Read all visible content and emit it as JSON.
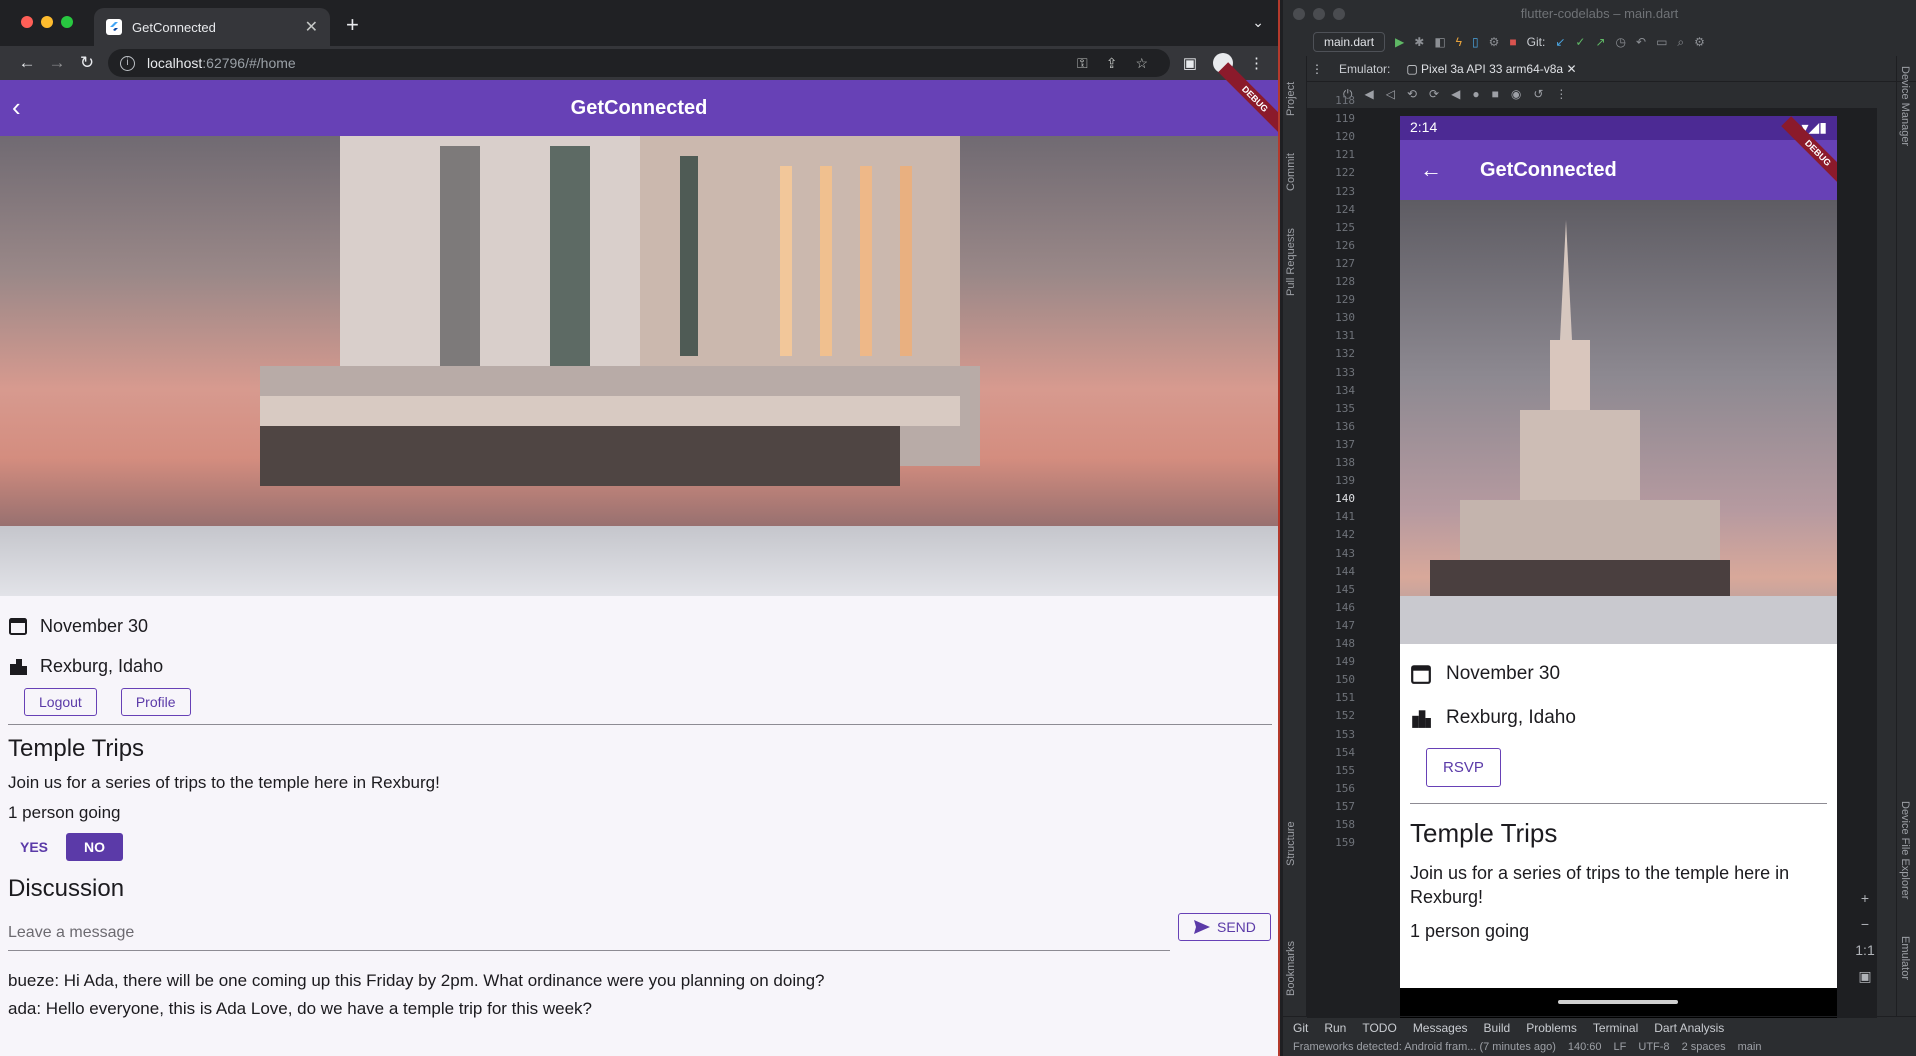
{
  "browser": {
    "tab_title": "GetConnected",
    "url_host": "localhost",
    "url_path": ":62796/#/home"
  },
  "webapp": {
    "title": "GetConnected",
    "debug_label": "DEBUG",
    "date": "November 30",
    "location": "Rexburg, Idaho",
    "logout_label": "Logout",
    "profile_label": "Profile",
    "event_title": "Temple Trips",
    "event_description": "Join us for a series of trips to the temple here in Rexburg!",
    "attendees": "1 person going",
    "yes_label": "YES",
    "no_label": "NO",
    "discussion_title": "Discussion",
    "message_placeholder": "Leave a message",
    "send_label": "SEND",
    "messages": [
      "bueze: Hi Ada, there will be one coming up this Friday by 2pm. What ordinance were you planning on doing?",
      "ada: Hello everyone, this is Ada Love, do we have a temple trip for this week?"
    ]
  },
  "studio": {
    "window_title": "flutter-codelabs – main.dart",
    "run_config": "main.dart",
    "git_label": "Git:",
    "emulator_label": "Emulator:",
    "device_tab": "Pixel 3a API 33 arm64-v8a",
    "left_strip": [
      "Project",
      "Commit",
      "Pull Requests",
      "Structure",
      "Bookmarks"
    ],
    "right_strip": [
      "Device Manager",
      "Device File Explorer",
      "Emulator"
    ],
    "line_numbers": [
      "118",
      "119",
      "120",
      "121",
      "122",
      "123",
      "124",
      "125",
      "126",
      "127",
      "128",
      "129",
      "130",
      "131",
      "132",
      "133",
      "134",
      "135",
      "136",
      "137",
      "138",
      "139",
      "140",
      "141",
      "142",
      "143",
      "144",
      "145",
      "146",
      "147",
      "148",
      "149",
      "150",
      "151",
      "152",
      "153",
      "154",
      "155",
      "156",
      "157",
      "158",
      "159"
    ],
    "active_line": "140",
    "bottom_tools": [
      "Git",
      "Run",
      "TODO",
      "Messages",
      "Build",
      "Problems",
      "Terminal",
      "Dart Analysis"
    ],
    "status_message": "Frameworks detected: Android fram... (7 minutes ago)",
    "cursor_pos": "140:60",
    "line_sep": "LF",
    "encoding": "UTF-8",
    "indent": "2 spaces",
    "branch": "main",
    "zoom_label": "1:1"
  },
  "phone": {
    "time": "2:14",
    "title": "GetConnected",
    "debug_label": "DEBUG",
    "date": "November 30",
    "location": "Rexburg, Idaho",
    "rsvp_label": "RSVP",
    "event_title": "Temple Trips",
    "event_description": "Join us for a series of trips to the temple here in Rexburg!",
    "attendees": "1 person going"
  },
  "colors": {
    "app_purple": "#6741b6",
    "button_purple": "#5b3aa8"
  }
}
